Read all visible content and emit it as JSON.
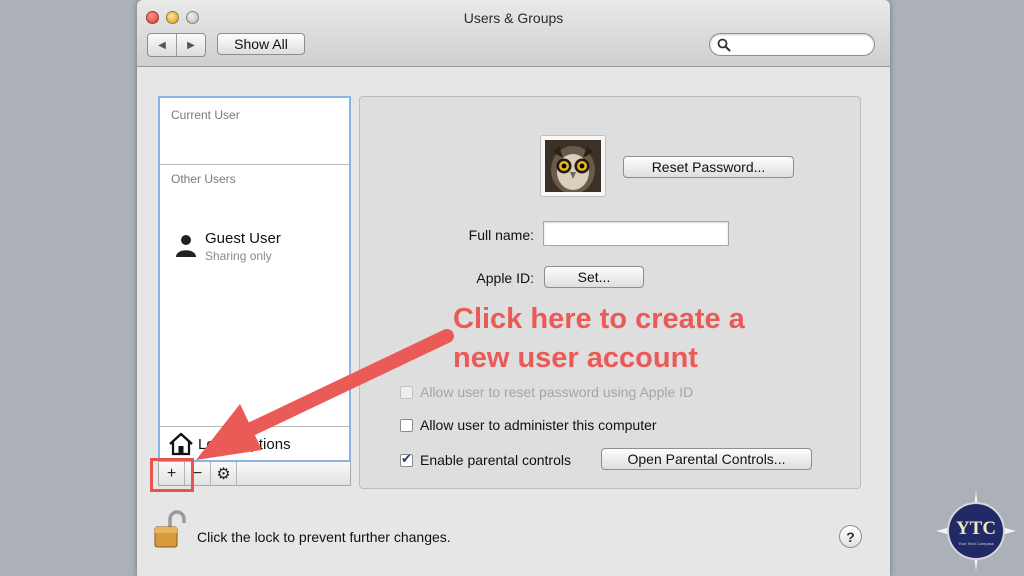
{
  "window": {
    "title": "Users & Groups",
    "back_label": "◀",
    "forward_label": "▶",
    "show_all_label": "Show All",
    "search_placeholder": ""
  },
  "sidebar": {
    "current_user_label": "Current User",
    "other_users_label": "Other Users",
    "users": [
      {
        "name": "Guest User",
        "subtitle": "Sharing only"
      }
    ],
    "login_options_label": "Login Options",
    "add_label": "+",
    "remove_label": "−",
    "gear_label": "⚙"
  },
  "details": {
    "reset_password_label": "Reset Password...",
    "full_name_label": "Full name:",
    "full_name_value": "",
    "apple_id_label": "Apple ID:",
    "set_label": "Set...",
    "checkboxes": [
      {
        "label": "Allow user to reset password using Apple ID",
        "checked": false,
        "enabled": false
      },
      {
        "label": "Allow user to administer this computer",
        "checked": false,
        "enabled": true
      },
      {
        "label": "Enable parental controls",
        "checked": true,
        "enabled": true
      }
    ],
    "open_parental_controls_label": "Open Parental Controls..."
  },
  "footer": {
    "lock_text": "Click the lock to prevent further changes.",
    "help_label": "?"
  },
  "annotation": {
    "lines": [
      "Click here to create a",
      "new user account"
    ],
    "color": "#ea5b57"
  },
  "watermark": {
    "text": "YTC",
    "subtitle": "Your Tech Compass"
  }
}
